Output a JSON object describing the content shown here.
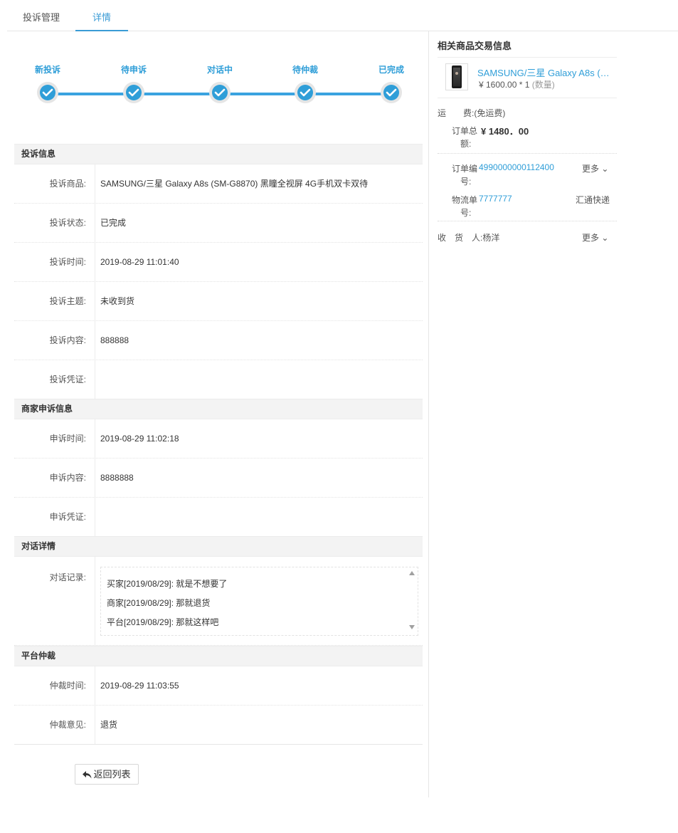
{
  "tabs": [
    {
      "label": "投诉管理"
    },
    {
      "label": "详情"
    }
  ],
  "progress": {
    "steps": [
      "新投诉",
      "待申诉",
      "对话中",
      "待仲裁",
      "已完成"
    ]
  },
  "complaint": {
    "title": "投诉信息",
    "rows": [
      {
        "key": "投诉商品:",
        "value": "SAMSUNG/三星 Galaxy A8s (SM-G8870) 黑瞳全视屏 4G手机双卡双待"
      },
      {
        "key": "投诉状态:",
        "value": "已完成"
      },
      {
        "key": "投诉时间:",
        "value": "2019-08-29 11:01:40"
      },
      {
        "key": "投诉主题:",
        "value": "未收到货"
      },
      {
        "key": "投诉内容:",
        "value": "888888"
      },
      {
        "key": "投诉凭证:",
        "value": ""
      }
    ]
  },
  "appeal": {
    "title": "商家申诉信息",
    "rows": [
      {
        "key": "申诉时间:",
        "value": "2019-08-29 11:02:18"
      },
      {
        "key": "申诉内容:",
        "value": "8888888"
      },
      {
        "key": "申诉凭证:",
        "value": ""
      }
    ]
  },
  "dialog": {
    "title": "对话详情",
    "key": "对话记录:",
    "lines": [
      "买家[2019/08/29]: 就是不想要了",
      "商家[2019/08/29]: 那就退货",
      "平台[2019/08/29]: 那就这样吧"
    ]
  },
  "arbitration": {
    "title": "平台仲裁",
    "rows": [
      {
        "key": "仲裁时间:",
        "value": "2019-08-29 11:03:55"
      },
      {
        "key": "仲裁意见:",
        "value": "退货"
      }
    ]
  },
  "back_button": "返回列表",
  "order": {
    "title": "相关商品交易信息",
    "product_name": "SAMSUNG/三星 Galaxy A8s (SM-G8870) 黑瞳全视屏 4G手机双卡双待",
    "product_price": "¥ 1600.00 * 1",
    "product_qty_note": "(数量)",
    "shipping_label": "运　　费:",
    "shipping_value": "(免运费)",
    "total_label_1": "订单总",
    "total_label_2": "额:",
    "total_value": "¥ 1480．00",
    "order_no_label_1": "订单编",
    "order_no_label_2": "号:",
    "order_no": "4990000000112400",
    "order_more": "更多",
    "logistics_label_1": "物流单",
    "logistics_label_2": "号:",
    "logistics_no": "7777777",
    "logistics_company": "汇通快递",
    "receiver_label": "收　货　人:",
    "receiver_name": "杨洋",
    "receiver_more": "更多"
  },
  "colors": {
    "accent": "#2f9ed8",
    "header_bg": "#f3f3f3"
  }
}
